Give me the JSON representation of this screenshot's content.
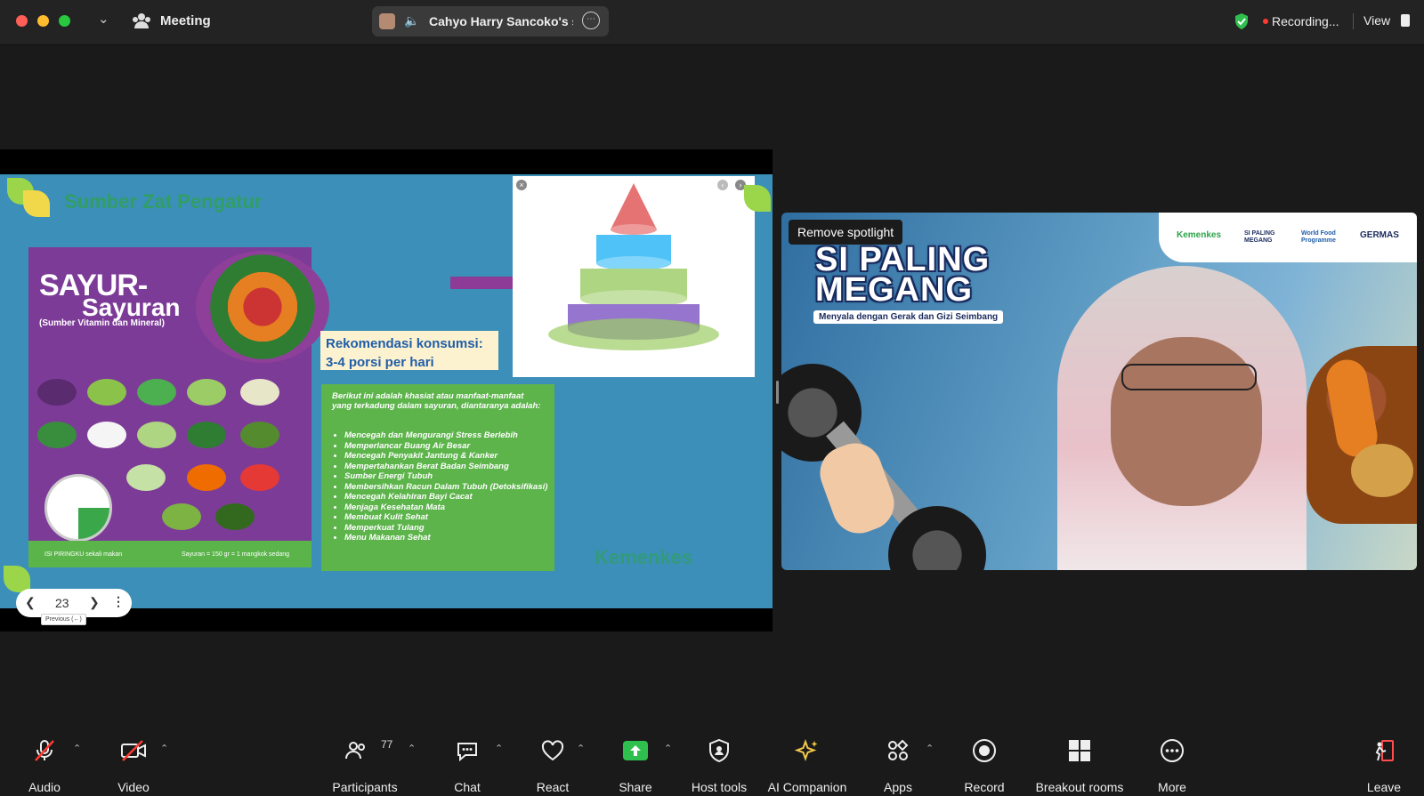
{
  "titlebar": {
    "meeting_label": "Meeting",
    "sharer_text": "Cahyo Harry Sancoko's s",
    "recording_label": "Recording...",
    "view_label": "View"
  },
  "slide": {
    "title": "Sumber Zat Pengatur",
    "poster": {
      "title_line1": "SAYUR-",
      "title_line2": "Sayuran",
      "subtitle": "(Sumber Vitamin dan Mineral)",
      "foot_left": "ISI PIRINGKU sekali makan",
      "foot_right": "Sayuran = 150 gr = 1 mangkok sedang"
    },
    "recommendation": [
      "Rekomendasi konsumsi:",
      "3-4 porsi per hari"
    ],
    "benefits_intro": "Berikut ini adalah khasiat atau manfaat-manfaat yang terkadung dalam sayuran, diantaranya adalah:",
    "benefits": [
      "Mencegah dan Mengurangi Stress Berlebih",
      "Memperlancar Buang Air Besar",
      "Mencegah Penyakit Jantung & Kanker",
      "Mempertahankan Berat Badan Seimbang",
      "Sumber Energi Tubuh",
      "Membersihkan Racun Dalam Tubuh (Detoksifikasi)",
      "Mencegah Kelahiran Bayi Cacat",
      "Menjaga Kesehatan Mata",
      "Membuat Kulit Sehat",
      "Memperkuat Tulang",
      "Menu Makanan Sehat"
    ],
    "brand": "Kemenkes",
    "page_number": "23",
    "tooltip": "Previous (←)"
  },
  "video": {
    "spotlight_button": "Remove spotlight",
    "brand_title_line1": "SI PALING",
    "brand_title_line2": "MEGANG",
    "brand_tagline": "Menyala dengan Gerak dan Gizi Seimbang",
    "logos": [
      "Kemenkes",
      "SI PALING MEGANG",
      "World Food Programme",
      "GERMAS"
    ]
  },
  "toolbar": {
    "audio": "Audio",
    "video": "Video",
    "participants": "Participants",
    "participants_count": "77",
    "chat": "Chat",
    "react": "React",
    "share": "Share",
    "host_tools": "Host tools",
    "ai_companion": "AI Companion",
    "apps": "Apps",
    "record": "Record",
    "breakout_rooms": "Breakout rooms",
    "more": "More",
    "leave": "Leave"
  },
  "colors": {
    "share_green": "#2fbf4f",
    "record_red": "#ff3b30",
    "slide_blue": "#3b8fb8",
    "poster_purple": "#7d3b98",
    "benefit_green": "#5cb44a"
  }
}
